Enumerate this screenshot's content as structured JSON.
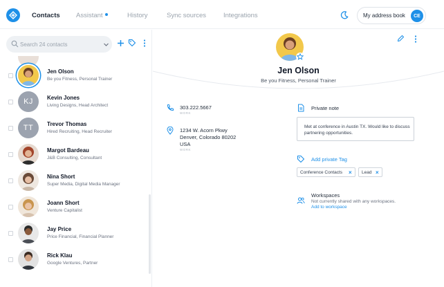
{
  "nav": {
    "tabs": [
      {
        "label": "Contacts",
        "active": true
      },
      {
        "label": "Assistant",
        "active": false,
        "has_dot": true
      },
      {
        "label": "History",
        "active": false
      },
      {
        "label": "Sync sources",
        "active": false
      },
      {
        "label": "Integrations",
        "active": false
      }
    ],
    "address_book_label": "My address book",
    "user_initials": "CE"
  },
  "search": {
    "placeholder": "Search 24 contacts"
  },
  "contacts": [
    {
      "name": "Jen Olson",
      "subtitle": "Be you Fitness, Personal Trainer",
      "avatar": "photo",
      "selected": true
    },
    {
      "name": "Kevin Jones",
      "subtitle": "Living Designs, Head Architect",
      "avatar": "initials",
      "initials": "KJ"
    },
    {
      "name": "Trevor Thomas",
      "subtitle": "Hired Recruiting, Head Recruiter",
      "avatar": "initials",
      "initials": "TT"
    },
    {
      "name": "Margot Bardeau",
      "subtitle": "J&B Consulting, Consultant",
      "avatar": "photo"
    },
    {
      "name": "Nina Short",
      "subtitle": "Super Media, Digital Media Manager",
      "avatar": "photo"
    },
    {
      "name": "Joann Short",
      "subtitle": "Venture Capitalist",
      "avatar": "photo"
    },
    {
      "name": "Jay Price",
      "subtitle": "Price Financial, Financial Planner",
      "avatar": "photo"
    },
    {
      "name": "Rick Klau",
      "subtitle": "Google Ventures, Partner",
      "avatar": "photo"
    }
  ],
  "detail": {
    "name": "Jen Olson",
    "subtitle": "Be you Fitness, Personal Trainer",
    "phone": "303.222.5667",
    "phone_type": "WORK",
    "address_line1": "1234 W. Acorn Pkwy",
    "address_line2": "Denver, Colorado 80202",
    "address_line3": "USA",
    "address_type": "WORK",
    "private_note_title": "Private note",
    "private_note_text": "Met at conference in Austin TX. Would like to discuss partnering opportunities.",
    "add_tag_label": "Add private Tag",
    "tags": [
      "Conference Contacts",
      "Lead"
    ],
    "workspaces_title": "Workspaces",
    "workspaces_sub": "Not currently shared with any workspaces.",
    "workspaces_link": "Add to workspace"
  },
  "colors": {
    "accent": "#1e90e8",
    "text": "#1f2937",
    "muted": "#9aa3ad"
  }
}
